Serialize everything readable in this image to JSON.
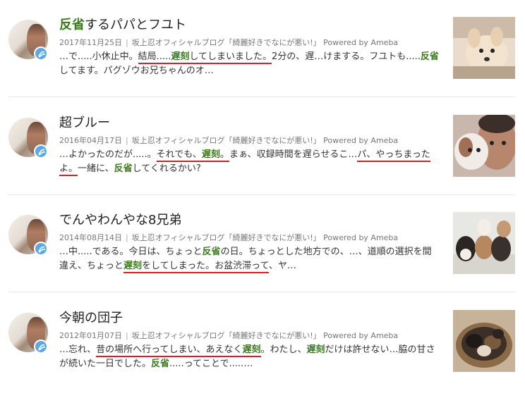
{
  "entries": [
    {
      "title_hl": "反省",
      "title_rest": "するパパとフユト",
      "date": "2017年11月25日",
      "blog": "坂上忍オフィシャルブログ「綺麗好きでなにが悪い!」",
      "powered": "Powered by Ameba",
      "snippet": [
        {
          "t": "…で.....小休止中。"
        },
        {
          "t": "結局.....",
          "u": true
        },
        {
          "t": "遅刻",
          "k": true,
          "u": true
        },
        {
          "t": "してしまいました。",
          "u": true
        },
        {
          "t": "2分の、遅…けまする。フユトも.....",
          "u": false
        },
        {
          "t": "反省",
          "k": true
        },
        {
          "t": "してます。パグゾウお兄ちゃんのオ…"
        }
      ],
      "thumb": "chihuahua-photo"
    },
    {
      "title_hl": "",
      "title_rest": "超ブルー",
      "date": "2016年04月17日",
      "blog": "坂上忍オフィシャルブログ「綺麗好きでなにが悪い!」",
      "powered": "Powered by Ameba",
      "snippet": [
        {
          "t": "…よかったのだが.....。"
        },
        {
          "t": "それでも、",
          "u": true
        },
        {
          "t": "遅刻",
          "k": true,
          "u": true
        },
        {
          "t": "。",
          "u": true
        },
        {
          "t": "まぁ、収録時間を遅らせるこ…"
        },
        {
          "t": "パ、やっちまったよ。",
          "u": true
        },
        {
          "t": "一緒に、"
        },
        {
          "t": "反省",
          "k": true
        },
        {
          "t": "してくれるかい?"
        }
      ],
      "thumb": "man-with-dog-photo"
    },
    {
      "title_hl": "",
      "title_rest": "でんやわんやな8兄弟",
      "date": "2014年08月14日",
      "blog": "坂上忍オフィシャルブログ「綺麗好きでなにが悪い!」",
      "powered": "Powered by Ameba",
      "snippet": [
        {
          "t": "…中.....である。今日は、ちょっと"
        },
        {
          "t": "反省",
          "k": true
        },
        {
          "t": "の日。ちょっとした地方での、…、道順の選択を間違え、ちょっと"
        },
        {
          "t": "遅刻",
          "k": true,
          "u": true
        },
        {
          "t": "をしてしまった。お盆渋滞って",
          "u": true
        },
        {
          "t": "、ヤ…"
        }
      ],
      "thumb": "puppies-photo"
    },
    {
      "title_hl": "",
      "title_rest": "今朝の団子",
      "date": "2012年01月07日",
      "blog": "坂上忍オフィシャルブログ「綺麗好きでなにが悪い!」",
      "powered": "Powered by Ameba",
      "snippet": [
        {
          "t": "…忘れ、"
        },
        {
          "t": "昔の場所へ行ってしまい、あえなく",
          "u": true
        },
        {
          "t": "遅刻",
          "k": true,
          "u": true
        },
        {
          "t": "。わたし、"
        },
        {
          "t": "遅刻",
          "k": true
        },
        {
          "t": "だけは許せない…脇の甘さが続いた一日でした。"
        },
        {
          "t": "反省",
          "k": true
        },
        {
          "t": ".....ってことで.....…"
        }
      ],
      "thumb": "dogs-in-basket-photo"
    }
  ],
  "colors": {
    "keyword": "#3a7a1c",
    "underline": "#d21f2a",
    "badge": "#5aa9e6"
  }
}
